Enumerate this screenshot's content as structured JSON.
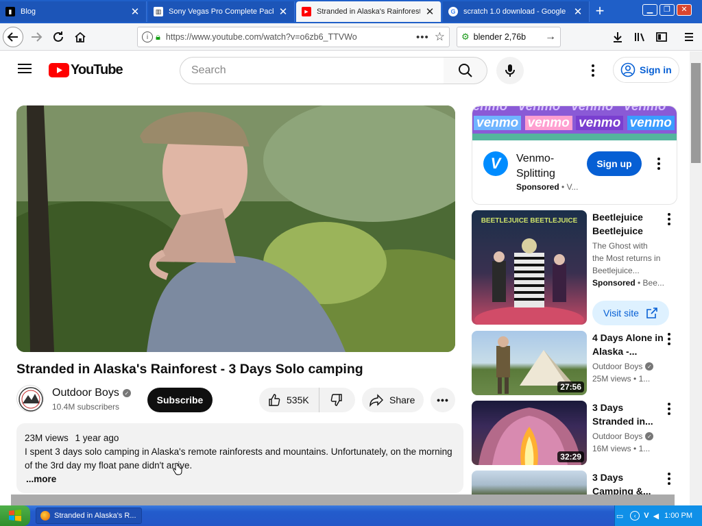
{
  "browser": {
    "tabs": [
      {
        "label": "Blog",
        "active": false,
        "icon": "blog-favicon"
      },
      {
        "label": "Sony Vegas Pro Complete Pack",
        "active": false,
        "icon": "document-favicon"
      },
      {
        "label": "Stranded in Alaska's Rainforest",
        "active": true,
        "icon": "youtube-favicon"
      },
      {
        "label": "scratch 1.0 download - Google S",
        "active": false,
        "icon": "google-favicon"
      }
    ],
    "new_tab_glyph": "+",
    "url": "https://www.youtube.com/watch?v=o6zb6_TTVWo",
    "search_value": "blender 2,76b"
  },
  "youtube": {
    "logo_text": "YouTube",
    "search_placeholder": "Search",
    "sign_in_label": "Sign in",
    "video": {
      "title": "Stranded in Alaska's Rainforest - 3 Days Solo camping",
      "channel": "Outdoor Boys",
      "subscribers": "10.4M subscribers",
      "subscribe_label": "Subscribe",
      "likes": "535K",
      "share_label": "Share",
      "views": "23M views",
      "age": "1 year ago",
      "description": "I spent 3 days solo camping in Alaska's remote rainforests and mountains. Unfortunately, on the morning of the 3rd day my float pane didn't arrive.",
      "more_label": "...more"
    },
    "ad": {
      "banner_word": "venmo",
      "title": "Venmo-Splitting",
      "sponsored": "Sponsored",
      "dot_meta": "V...",
      "cta_label": "Sign up"
    },
    "sidebar": [
      {
        "title": "Beetlejuice Beetlejuice",
        "channel": "",
        "description": "The Ghost with the Most returns in Beetlejuice...",
        "meta": "Sponsored",
        "meta2": "Bee...",
        "duration": "",
        "cta": "Visit site",
        "poster_text": "BEETLEJUICE BEETLEJUICE"
      },
      {
        "title": "4 Days Alone in Alaska -...",
        "channel": "Outdoor Boys",
        "meta": "25M views",
        "meta2": "1...",
        "duration": "27:56"
      },
      {
        "title": "3 Days Stranded in...",
        "channel": "Outdoor Boys",
        "meta": "16M views",
        "meta2": "1...",
        "duration": "32:29"
      },
      {
        "title": "3 Days Camping &...",
        "channel": "",
        "meta": "",
        "meta2": "",
        "duration": ""
      }
    ]
  },
  "taskbar": {
    "start_label": "start",
    "window_item": "Stranded in Alaska's R...",
    "clock": "1:00 PM"
  },
  "colors": {
    "youtube_red": "#ff0000",
    "link_blue": "#065fd4",
    "venmo_blue": "#008cff",
    "xp_taskbar": "#245edb"
  }
}
